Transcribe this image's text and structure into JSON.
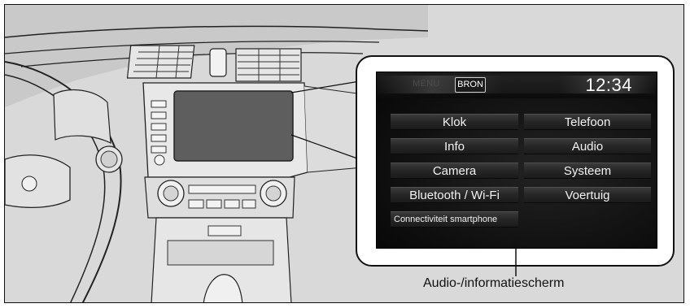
{
  "screen": {
    "menu_label": "MENU",
    "source_label": "BRON",
    "time": "12:34",
    "menu_items": [
      {
        "key": "klok",
        "label": "Klok"
      },
      {
        "key": "telefoon",
        "label": "Telefoon"
      },
      {
        "key": "info",
        "label": "Info"
      },
      {
        "key": "audio",
        "label": "Audio"
      },
      {
        "key": "camera",
        "label": "Camera"
      },
      {
        "key": "systeem",
        "label": "Systeem"
      },
      {
        "key": "bluetooth",
        "label": "Bluetooth / Wi-Fi"
      },
      {
        "key": "voertuig",
        "label": "Voertuig"
      },
      {
        "key": "connectiviteit",
        "label": "Connectiviteit smartphone"
      }
    ]
  },
  "caption": "Audio-/informatiescherm",
  "colors": {
    "frame_background": "#d9d9d9",
    "screen_background": "#121212",
    "button_face": "#2a2a2a",
    "text_light": "#ffffff",
    "menu_disabled": "#4c4c4c"
  }
}
